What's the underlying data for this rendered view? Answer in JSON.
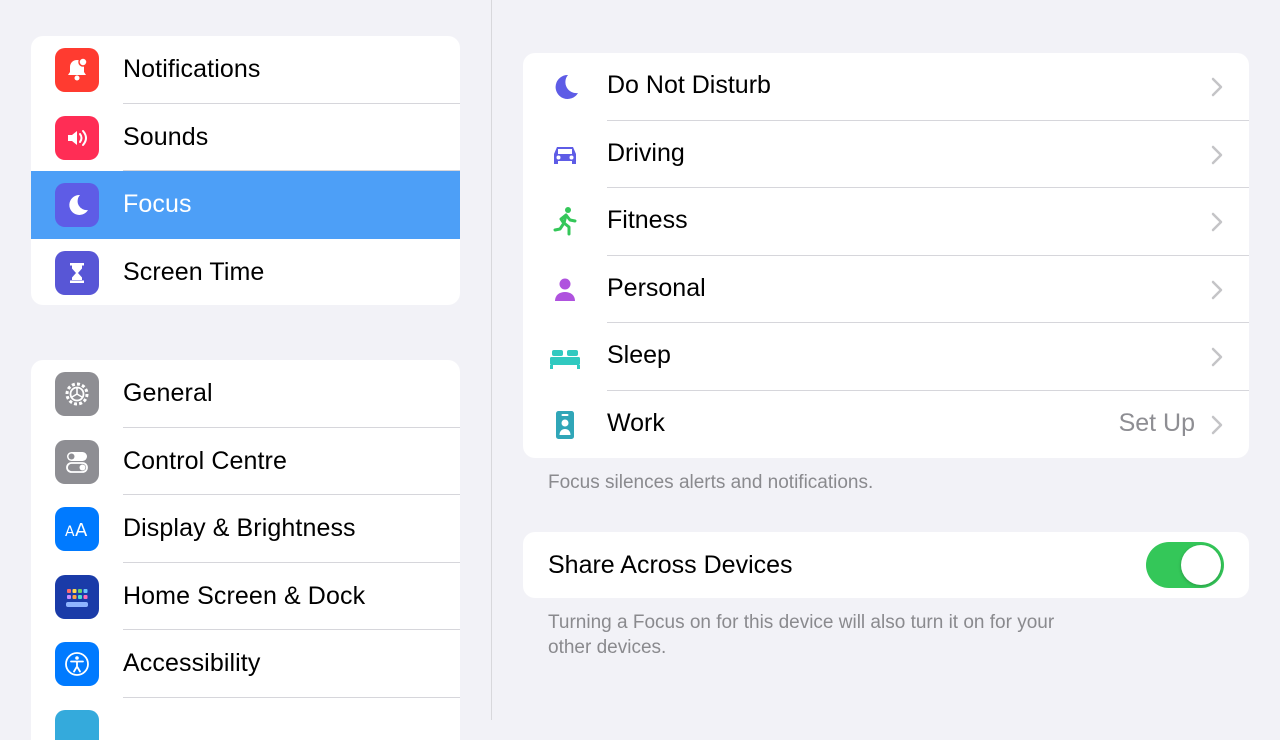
{
  "sidebar": {
    "group1": [
      {
        "label": "Notifications",
        "icon": "bell-badge-icon",
        "color": "#ff3b30"
      },
      {
        "label": "Sounds",
        "icon": "speaker-wave-icon",
        "color": "#ff2d55"
      },
      {
        "label": "Focus",
        "icon": "moon-icon",
        "color": "#5e5ce6",
        "selected": true
      },
      {
        "label": "Screen Time",
        "icon": "hourglass-icon",
        "color": "#5856d6"
      }
    ],
    "group2": [
      {
        "label": "General",
        "icon": "gear-icon",
        "color": "#8e8e93"
      },
      {
        "label": "Control Centre",
        "icon": "switches-icon",
        "color": "#8e8e93"
      },
      {
        "label": "Display & Brightness",
        "icon": "text-size-icon",
        "color": "#007aff"
      },
      {
        "label": "Home Screen & Dock",
        "icon": "app-grid-icon",
        "color": "#1a3ba8"
      },
      {
        "label": "Accessibility",
        "icon": "accessibility-icon",
        "color": "#007aff"
      }
    ],
    "selected_color": "#4d9ff7"
  },
  "focus_modes": [
    {
      "label": "Do Not Disturb",
      "icon": "moon-icon",
      "color": "#5e5ce6",
      "value": ""
    },
    {
      "label": "Driving",
      "icon": "car-icon",
      "color": "#5e5ce6",
      "value": ""
    },
    {
      "label": "Fitness",
      "icon": "running-figure-icon",
      "color": "#34c759",
      "value": ""
    },
    {
      "label": "Personal",
      "icon": "person-icon",
      "color": "#af52de",
      "value": ""
    },
    {
      "label": "Sleep",
      "icon": "bed-icon",
      "color": "#30c9c0",
      "value": ""
    },
    {
      "label": "Work",
      "icon": "id-badge-icon",
      "color": "#30a6b8",
      "value": "Set Up"
    }
  ],
  "focus_footnote": "Focus silences alerts and notifications.",
  "share": {
    "label": "Share Across Devices",
    "enabled": true,
    "footnote_line1": "Turning a Focus on for this device will also turn it on for your",
    "footnote_line2": "other devices."
  },
  "colors": {
    "toggle_on": "#34c759",
    "background": "#f2f2f7"
  }
}
